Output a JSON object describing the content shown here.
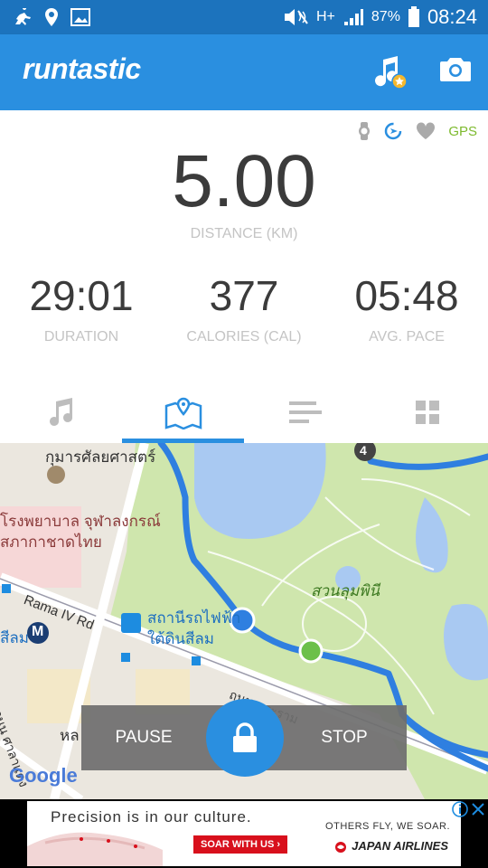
{
  "status_bar": {
    "battery": "87%",
    "time": "08:24",
    "network": "H+"
  },
  "app": {
    "title": "runtastic"
  },
  "sensors": {
    "gps_label": "GPS"
  },
  "stats": {
    "distance": {
      "value": "5.00",
      "label": "DISTANCE (KM)"
    },
    "duration": {
      "value": "29:01",
      "label": "DURATION"
    },
    "calories": {
      "value": "377",
      "label": "CALORIES (CAL)"
    },
    "pace": {
      "value": "05:48",
      "label": "AVG. PACE"
    }
  },
  "tabs": [
    {
      "name": "music",
      "icon": "music-note-icon"
    },
    {
      "name": "map",
      "icon": "map-pin-icon",
      "active": true
    },
    {
      "name": "splits",
      "icon": "bars-icon"
    },
    {
      "name": "dashboard",
      "icon": "grid-icon"
    }
  ],
  "map": {
    "labels": {
      "museum": "กุมารศัลยศาสตร์",
      "hospital_line1": "โรงพยาบาล จุฬาลงกรณ์",
      "hospital_line2": "สภากาชาดไทย",
      "road": "Rama IV Rd",
      "station_line1": "สถานีรถไฟฟ้า",
      "station_line2": "ใต้ดินสีลม",
      "park": "สวนลุมพินี",
      "silom_partial": "สีลม",
      "road2": "ถนน พระราม",
      "road3": "ถนน ศาลาแดง",
      "partial": "หล",
      "km_marker": "4",
      "metro_marker": "M",
      "google": "Google"
    }
  },
  "controls": {
    "pause": "PAUSE",
    "stop": "STOP"
  },
  "ad": {
    "headline": "Precision is in our culture.",
    "cta": "SOAR WITH US ›",
    "slogan": "OTHERS FLY, WE SOAR.",
    "brand": "JAPAN AIRLINES"
  },
  "colors": {
    "primary": "#2A8FE0",
    "status_bar": "#1C73BD",
    "route": "#2F7FE0",
    "gps_green": "#7DBA2E",
    "park": "#cfe6ad",
    "water": "#a9c9f2"
  }
}
